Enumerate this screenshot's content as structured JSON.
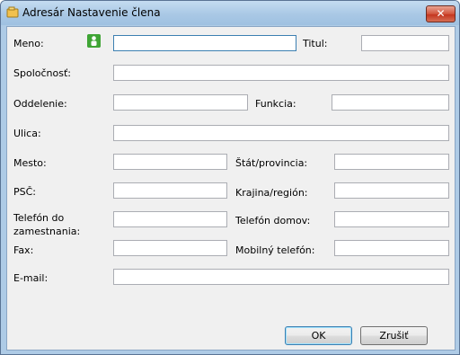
{
  "window": {
    "title": "Adresár Nastavenie člena",
    "close_label": "✕"
  },
  "fields": {
    "meno": {
      "label": "Meno:",
      "value": ""
    },
    "titul": {
      "label": "Titul:",
      "value": ""
    },
    "spolocnost": {
      "label": "Spoločnosť:",
      "value": ""
    },
    "oddelenie": {
      "label": "Oddelenie:",
      "value": ""
    },
    "funkcia": {
      "label": "Funkcia:",
      "value": ""
    },
    "ulica": {
      "label": "Ulica:",
      "value": ""
    },
    "mesto": {
      "label": "Mesto:",
      "value": ""
    },
    "stat": {
      "label": "Štát/provincia:",
      "value": ""
    },
    "psc": {
      "label": "PSČ:",
      "value": ""
    },
    "krajina": {
      "label": "Krajina/región:",
      "value": ""
    },
    "telefon_zam": {
      "label": "Telefón do zamestnania:",
      "value": ""
    },
    "telefon_domov": {
      "label": "Telefón domov:",
      "value": ""
    },
    "fax": {
      "label": "Fax:",
      "value": ""
    },
    "mobil": {
      "label": "Mobilný telefón:",
      "value": ""
    },
    "email": {
      "label": "E-mail:",
      "value": ""
    }
  },
  "buttons": {
    "ok": "OK",
    "cancel": "Zrušiť"
  },
  "icons": {
    "title": "address-book-icon",
    "person": "person-icon"
  }
}
